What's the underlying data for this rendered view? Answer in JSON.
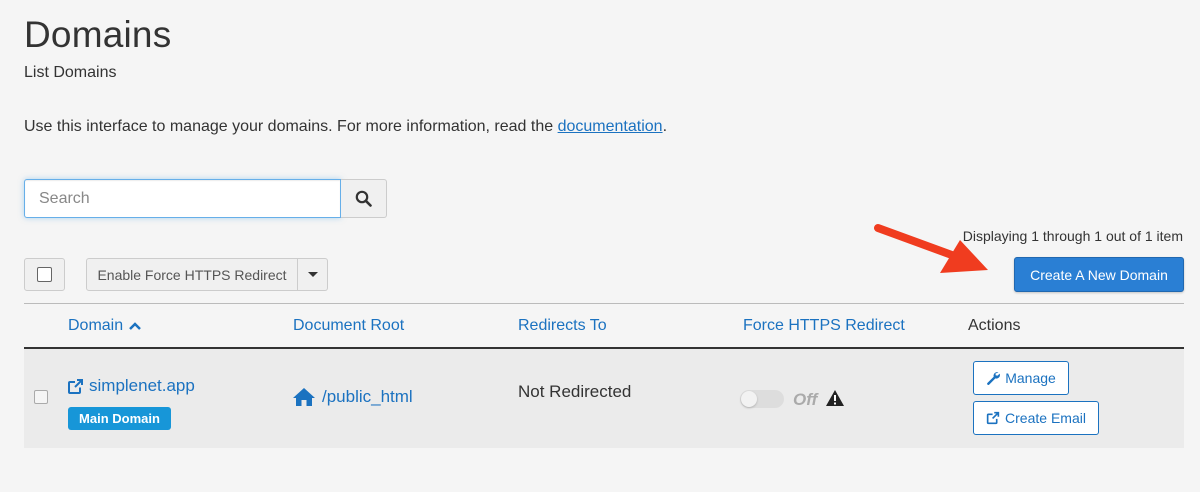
{
  "page": {
    "title": "Domains",
    "subtitle": "List Domains",
    "intro_text": "Use this interface to manage your domains. For more information, read the ",
    "intro_link": "documentation",
    "intro_end": "."
  },
  "search": {
    "placeholder": "Search",
    "value": "",
    "button_icon": "search-icon"
  },
  "toolbar": {
    "display_count": "Displaying 1 through 1 out of 1 item",
    "bulk_action_label": "Enable Force HTTPS Redirect",
    "create_label": "Create A New Domain"
  },
  "table": {
    "columns": [
      "Domain",
      "Document Root",
      "Redirects To",
      "Force HTTPS Redirect",
      "Actions"
    ],
    "sorted_column": "Domain",
    "sort_direction": "ascending",
    "rows": [
      {
        "domain": "simplenet.app",
        "badge": "Main Domain",
        "document_root": "/public_html",
        "redirects_to": "Not Redirected",
        "force_https_state": "Off",
        "actions": [
          "Manage",
          "Create Email"
        ]
      }
    ]
  },
  "colors": {
    "link": "#1b72c0",
    "primary_button": "#2a7fd4",
    "badge": "#1796d8",
    "annotation_arrow": "#f03c1f"
  }
}
